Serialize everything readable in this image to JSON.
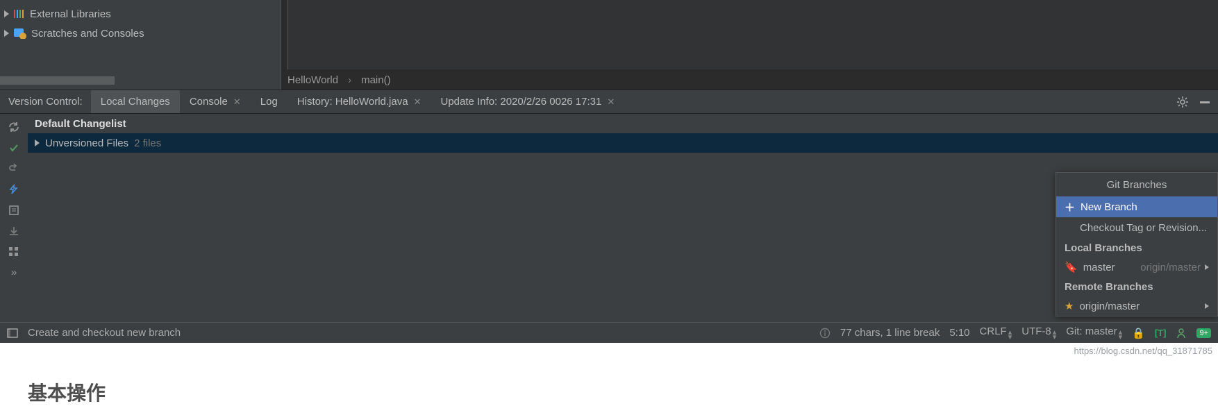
{
  "project_tree": {
    "items": [
      {
        "label": "External Libraries"
      },
      {
        "label": "Scratches and Consoles"
      }
    ]
  },
  "breadcrumb": {
    "class_name": "HelloWorld",
    "method": "main()"
  },
  "version_control": {
    "title": "Version Control:",
    "tabs": {
      "local_changes": "Local Changes",
      "console": "Console",
      "log": "Log",
      "history": "History: HelloWorld.java",
      "update_info": "Update Info: 2020/2/26 0026 17:31"
    }
  },
  "changes": {
    "default_changelist": "Default Changelist",
    "unversioned_label": "Unversioned Files",
    "unversioned_count": "2 files"
  },
  "git_popup": {
    "title": "Git Branches",
    "new_branch": "New Branch",
    "checkout": "Checkout Tag or Revision...",
    "local_header": "Local Branches",
    "local_branch": "master",
    "local_tracking": "origin/master",
    "remote_header": "Remote Branches",
    "remote_branch": "origin/master"
  },
  "status_bar": {
    "hint": "Create and checkout new branch",
    "chars": "77 chars, 1 line break",
    "caret": "5:10",
    "line_sep": "CRLF",
    "encoding": "UTF-8",
    "git": "Git: master"
  },
  "watermark_url": "https://blog.csdn.net/qq_31871785",
  "below_heading": "基本操作"
}
